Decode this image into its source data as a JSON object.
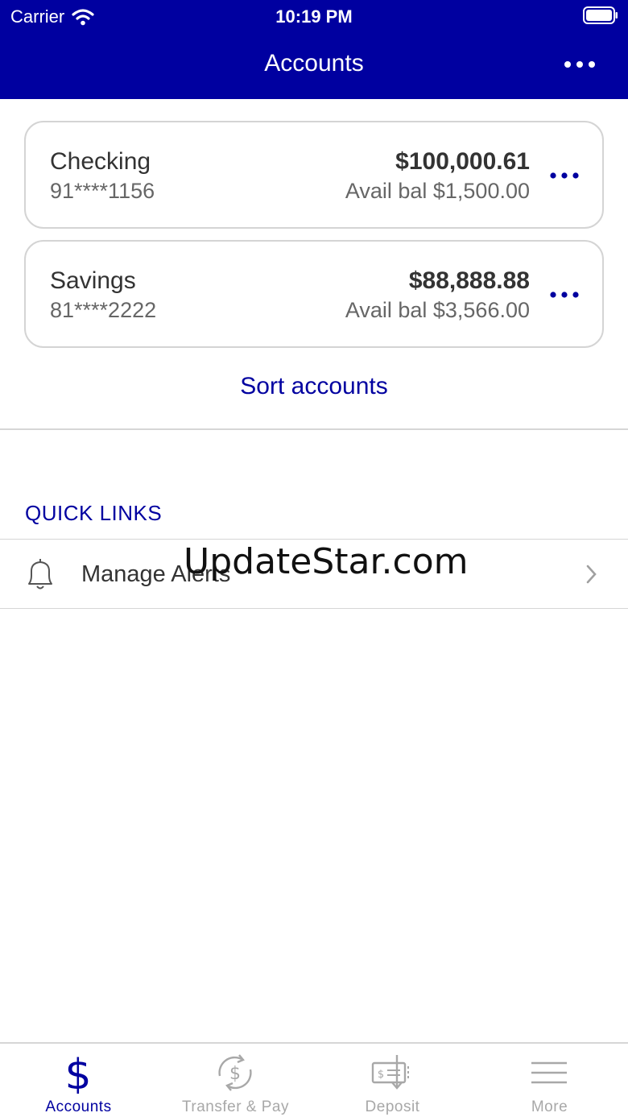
{
  "status_bar": {
    "carrier": "Carrier",
    "time": "10:19 PM"
  },
  "header": {
    "title": "Accounts",
    "more_icon": "ellipsis-icon"
  },
  "accounts": [
    {
      "name": "Checking",
      "number": "91****1156",
      "balance": "$100,000.61",
      "available": "Avail bal $1,500.00"
    },
    {
      "name": "Savings",
      "number": "81****2222",
      "balance": "$88,888.88",
      "available": "Avail bal $3,566.00"
    }
  ],
  "sort_label": "Sort accounts",
  "quick_links": {
    "title": "QUICK LINKS",
    "items": [
      {
        "label": "Manage Alerts",
        "icon": "bell-icon"
      }
    ]
  },
  "watermark": "UpdateStar.com",
  "tabs": [
    {
      "label": "Accounts",
      "icon": "dollar-icon",
      "active": true
    },
    {
      "label": "Transfer & Pay",
      "icon": "transfer-icon",
      "active": false
    },
    {
      "label": "Deposit",
      "icon": "deposit-check-icon",
      "active": false
    },
    {
      "label": "More",
      "icon": "menu-icon",
      "active": false
    }
  ],
  "colors": {
    "brand": "#0000a0",
    "text": "#333333",
    "muted": "#666666",
    "inactive": "#a8a8a8",
    "border": "#d4d4d4"
  }
}
